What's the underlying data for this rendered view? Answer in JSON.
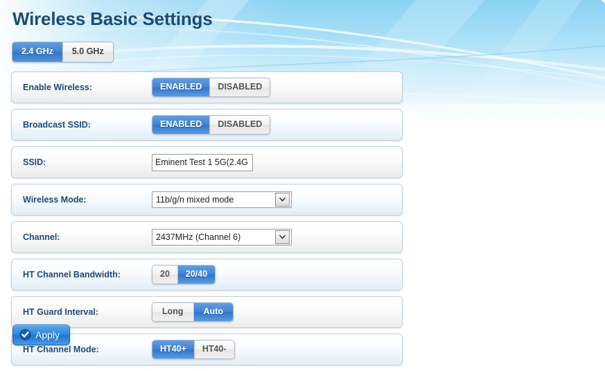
{
  "page": {
    "title": "Wireless Basic Settings"
  },
  "band_tabs": {
    "items": [
      {
        "label": "2.4 GHz",
        "active": true
      },
      {
        "label": "5.0 GHz",
        "active": false
      }
    ]
  },
  "settings": {
    "rows": [
      {
        "name": "enable-wireless",
        "label": "Enable Wireless:",
        "type": "toggle",
        "options": [
          "ENABLED",
          "DISABLED"
        ],
        "selected": "ENABLED"
      },
      {
        "name": "broadcast-ssid",
        "label": "Broadcast SSID:",
        "type": "toggle",
        "options": [
          "ENABLED",
          "DISABLED"
        ],
        "selected": "ENABLED"
      },
      {
        "name": "ssid",
        "label": "SSID:",
        "type": "text",
        "value": "Eminent Test 1 5G(2.4G"
      },
      {
        "name": "wireless-mode",
        "label": "Wireless Mode:",
        "type": "select",
        "value": "11b/g/n mixed mode"
      },
      {
        "name": "channel",
        "label": "Channel:",
        "type": "select",
        "value": "2437MHz (Channel 6)"
      },
      {
        "name": "ht-channel-bandwidth",
        "label": "HT Channel Bandwidth:",
        "type": "toggle",
        "options": [
          "20",
          "20/40"
        ],
        "selected": "20/40"
      },
      {
        "name": "ht-guard-interval",
        "label": "HT Guard Interval:",
        "type": "toggle",
        "options": [
          "Long",
          "Auto"
        ],
        "selected": "Auto"
      },
      {
        "name": "ht-channel-mode",
        "label": "HT Channel Mode:",
        "type": "toggle",
        "options": [
          "HT40+",
          "HT40-"
        ],
        "selected": "HT40+"
      }
    ]
  },
  "apply_button": {
    "label": "Apply",
    "icon": "check-circle-icon"
  },
  "colors": {
    "title": "#1b4a78",
    "accent_blue": "#3f82d2",
    "banner_blue": "#7fcdf0",
    "row_border": "#bdd0de"
  }
}
